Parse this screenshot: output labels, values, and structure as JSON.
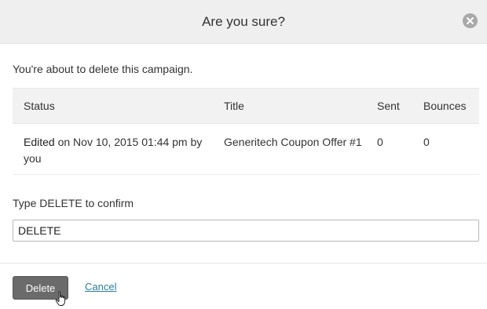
{
  "modal": {
    "title": "Are you sure?",
    "close_icon": "close-icon",
    "message": "You're about to delete this campaign."
  },
  "table": {
    "headers": {
      "status": "Status",
      "title": "Title",
      "sent": "Sent",
      "bounces": "Bounces"
    },
    "rows": [
      {
        "status_word": "Edited",
        "status_detail": " on Nov 10, 2015 01:44 pm by you",
        "title": "Generitech Coupon Offer #1",
        "sent": "0",
        "bounces": "0"
      }
    ]
  },
  "confirm": {
    "label": "Type DELETE to confirm",
    "value": "DELETE"
  },
  "footer": {
    "delete_label": "Delete",
    "cancel_label": "Cancel"
  },
  "colors": {
    "header_bg": "#efefef",
    "delete_button": "#6b6b6b",
    "link": "#2b7c9e"
  }
}
